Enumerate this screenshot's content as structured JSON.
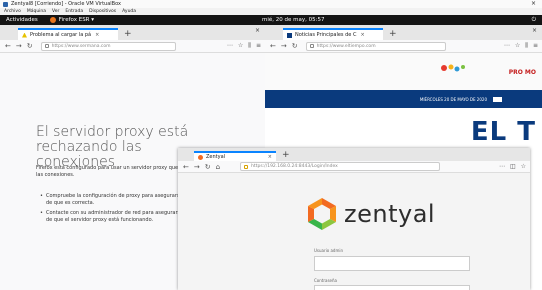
{
  "vbox": {
    "title": "Zentyal8 [Corriendo] - Oracle VM VirtualBox",
    "menu": [
      "Archivo",
      "Máquina",
      "Ver",
      "Entrada",
      "Dispositivos",
      "Ayuda"
    ],
    "close": "×"
  },
  "gnome": {
    "activities": "Actividades",
    "app": "Firefox ESR ▾",
    "clock": "mié, 20 de may, 05:57",
    "tray": "⏻"
  },
  "w1": {
    "tab": "Problema al cargar la pá",
    "url": "https://www.sermana.com",
    "error_title": "El servidor proxy está rechazando las conexiones",
    "error_desc": "Firefox está configurado para usar un servidor proxy que está rechazando las conexiones.",
    "list": [
      "Compruebe la configuración de proxy para asegurarse de que es correcta.",
      "Contacte con su administrador de red para asegurarse de que el servidor proxy está funcionando."
    ]
  },
  "w2": {
    "tab": "Noticias Principales de C",
    "url": "https://www.eltiempo.com",
    "date": "MIÉRCOLES 20 DE MAYO DE 2020",
    "logo": "EL T",
    "promo": "PRO MO"
  },
  "w3": {
    "tab": "Zentyal",
    "url": "https://192.168.0.24:8443/Login/Index",
    "brand": "zentyal",
    "user_label": "Usuario admin",
    "pass_label": "Contraseña"
  },
  "colors": {
    "firefox_blue": "#0a84ff",
    "zentyal_orange": "#f26a21",
    "zentyal_green": "#8cc63f",
    "news_blue": "#0a3a7d"
  }
}
